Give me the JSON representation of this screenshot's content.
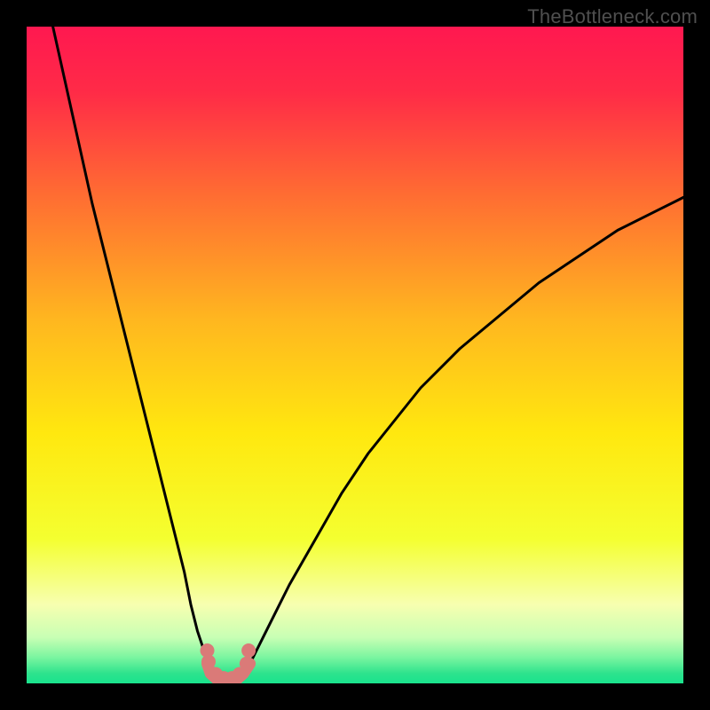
{
  "watermark": "TheBottleneck.com",
  "colors": {
    "black": "#000000",
    "curve": "#000000",
    "markerFill": "#da7a78",
    "markerStroke": "#da7a78"
  },
  "chart_data": {
    "type": "line",
    "title": "",
    "xlabel": "",
    "ylabel": "",
    "xlim": [
      0,
      100
    ],
    "ylim": [
      0,
      100
    ],
    "grid": false,
    "series": [
      {
        "name": "left-branch",
        "x": [
          4,
          6,
          8,
          10,
          12,
          14,
          16,
          18,
          20,
          22,
          24,
          25,
          26,
          27,
          27.5
        ],
        "y": [
          100,
          91,
          82,
          73,
          65,
          57,
          49,
          41,
          33,
          25,
          17,
          12,
          8,
          5,
          3
        ]
      },
      {
        "name": "right-branch",
        "x": [
          34,
          35,
          36,
          38,
          40,
          44,
          48,
          52,
          56,
          60,
          66,
          72,
          78,
          84,
          90,
          96,
          100
        ],
        "y": [
          3,
          5,
          7,
          11,
          15,
          22,
          29,
          35,
          40,
          45,
          51,
          56,
          61,
          65,
          69,
          72,
          74
        ]
      },
      {
        "name": "valley-floor",
        "x": [
          27.5,
          28,
          29,
          30,
          31,
          32,
          33,
          34
        ],
        "y": [
          3,
          1.5,
          0.6,
          0.3,
          0.3,
          0.6,
          1.5,
          3
        ]
      }
    ],
    "markers": [
      {
        "x": 27.5,
        "y": 5.0
      },
      {
        "x": 27.7,
        "y": 3.3
      },
      {
        "x": 28.8,
        "y": 1.4
      },
      {
        "x": 30.0,
        "y": 0.8
      },
      {
        "x": 31.3,
        "y": 0.8
      },
      {
        "x": 32.4,
        "y": 1.4
      },
      {
        "x": 33.5,
        "y": 3.0
      },
      {
        "x": 33.8,
        "y": 5.0
      }
    ],
    "gradient_stops": [
      {
        "pos": 0.0,
        "color": "#ff1850"
      },
      {
        "pos": 0.1,
        "color": "#ff2b47"
      },
      {
        "pos": 0.25,
        "color": "#ff6a33"
      },
      {
        "pos": 0.45,
        "color": "#ffb81f"
      },
      {
        "pos": 0.62,
        "color": "#ffe80f"
      },
      {
        "pos": 0.78,
        "color": "#f4ff30"
      },
      {
        "pos": 0.88,
        "color": "#f7ffb0"
      },
      {
        "pos": 0.93,
        "color": "#c8ffb4"
      },
      {
        "pos": 0.96,
        "color": "#7cf5a0"
      },
      {
        "pos": 0.985,
        "color": "#2de38d"
      },
      {
        "pos": 1.0,
        "color": "#19e38d"
      }
    ]
  }
}
